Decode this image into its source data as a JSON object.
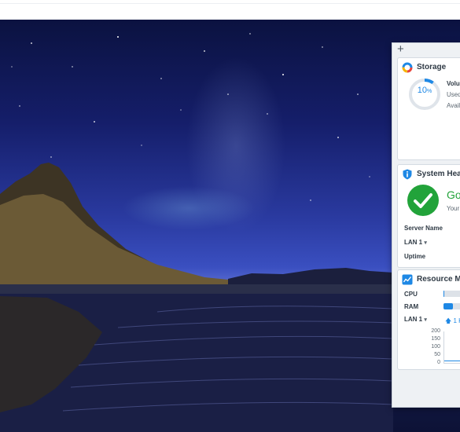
{
  "colors": {
    "accent": "#1e88e5",
    "healthy": "#22a33a",
    "panel_bg": "#eef1f4"
  },
  "widgets": {
    "add_icon": "plus-icon",
    "add_label": "+",
    "storage": {
      "title": "Storage",
      "icon": "storage-donut-icon",
      "usage_percent": "10",
      "usage_unit": "%",
      "usage_fraction": 0.1,
      "volume_label": "Volu",
      "used_label": "Used",
      "available_label": "Avail"
    },
    "system_health": {
      "title": "System Heal",
      "icon": "info-shield-icon",
      "status_text": "Go",
      "status_sub": "Your",
      "server_name_label": "Server Name",
      "lan_label": "LAN 1",
      "uptime_label": "Uptime"
    },
    "resource_monitor": {
      "title": "Resource Mo",
      "icon": "resource-chart-icon",
      "cpu_label": "CPU",
      "ram_label": "RAM",
      "lan_label": "LAN 1",
      "cpu_fraction": 0.05,
      "ram_fraction": 0.45,
      "upload_label": "1 K",
      "y_ticks": [
        "200",
        "150",
        "100",
        "50",
        "0"
      ]
    }
  }
}
